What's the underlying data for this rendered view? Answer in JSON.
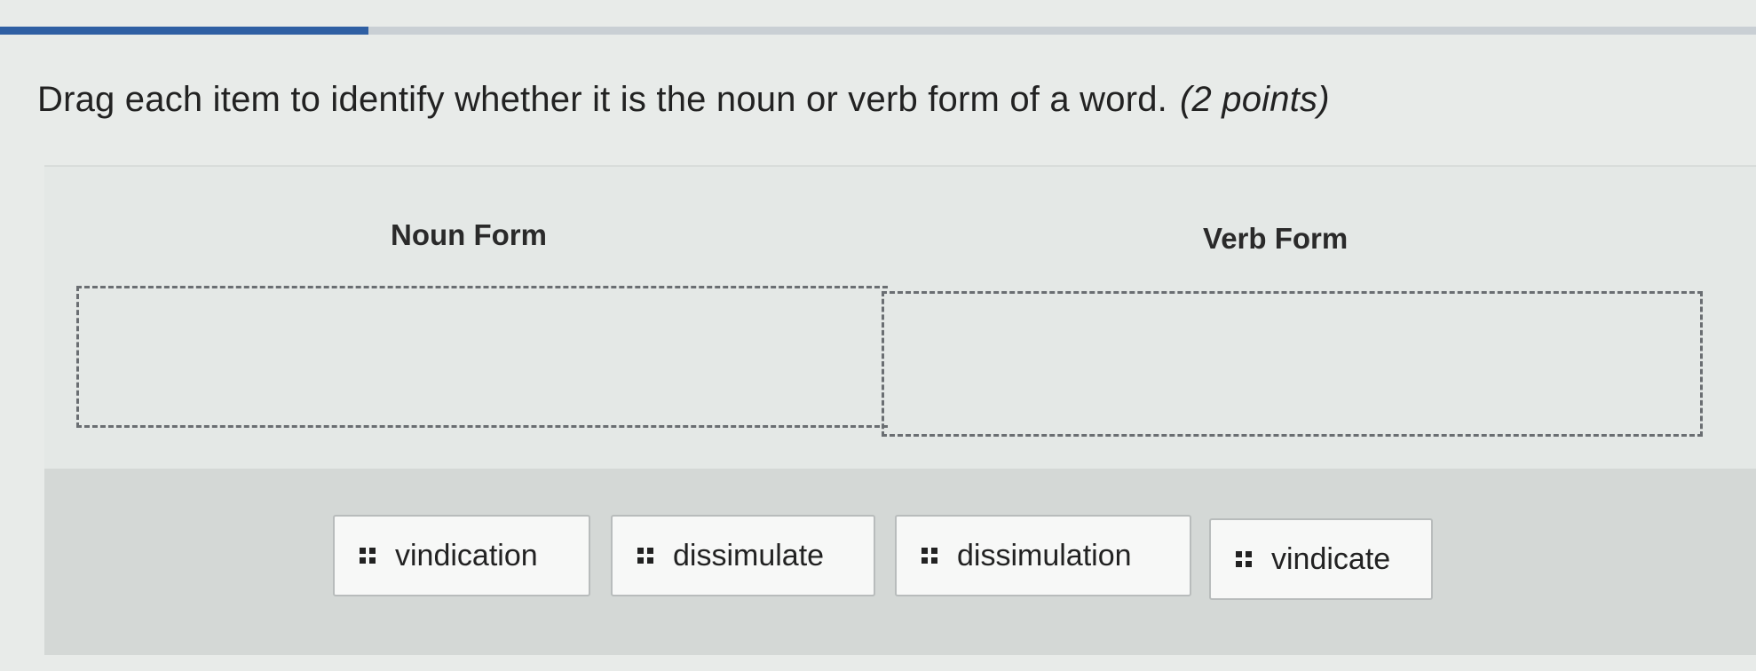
{
  "progress": {
    "value_percent": 21,
    "fill_color": "#2f5fa3"
  },
  "question": {
    "prompt": "Drag each item to identify whether it is the noun or verb form of a word.",
    "points": "(2 points)"
  },
  "columns": [
    {
      "label": "Noun Form"
    },
    {
      "label": "Verb Form"
    }
  ],
  "items": [
    {
      "label": "vindication",
      "icon": "drag-handle-icon"
    },
    {
      "label": "dissimulate",
      "icon": "drag-handle-icon"
    },
    {
      "label": "dissimulation",
      "icon": "drag-handle-icon"
    },
    {
      "label": "vindicate",
      "icon": "drag-handle-icon"
    }
  ]
}
